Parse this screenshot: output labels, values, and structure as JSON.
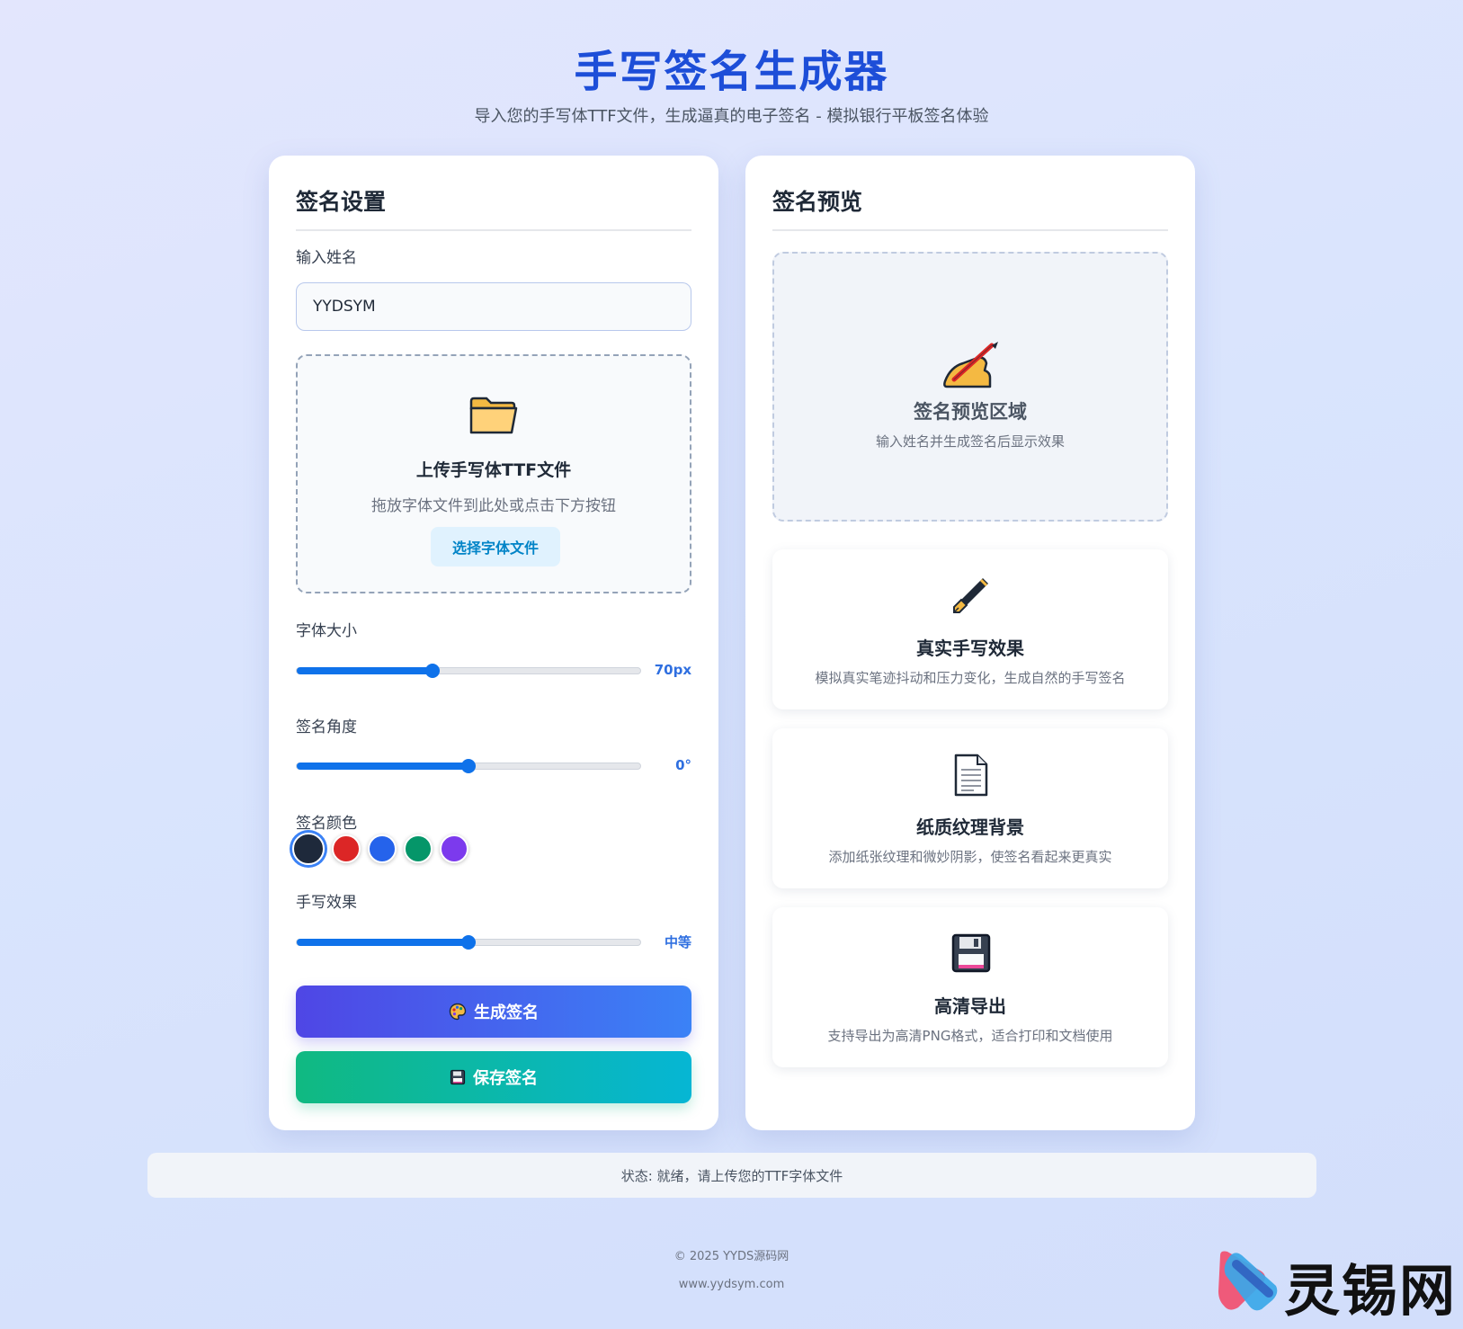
{
  "header": {
    "title": "手写签名生成器",
    "subtitle": "导入您的手写体TTF文件，生成逼真的电子签名 - 模拟银行平板签名体验"
  },
  "settings": {
    "title": "签名设置",
    "name_label": "输入姓名",
    "name_value": "YYDSYM",
    "upload": {
      "title": "上传手写体TTF文件",
      "hint": "拖放字体文件到此处或点击下方按钮",
      "button": "选择字体文件"
    },
    "font_size": {
      "label": "字体大小",
      "value_text": "70px",
      "fraction": 0.395
    },
    "angle": {
      "label": "签名角度",
      "value_text": "0°",
      "fraction": 0.5
    },
    "color": {
      "label": "签名颜色",
      "options": [
        "#1e293b",
        "#dc2626",
        "#2563eb",
        "#059669",
        "#7c3aed"
      ],
      "selected": 0
    },
    "effect": {
      "label": "手写效果",
      "value_text": "中等",
      "fraction": 0.5
    },
    "generate_button": "生成签名",
    "save_button": "保存签名"
  },
  "preview": {
    "title": "签名预览",
    "area_title": "签名预览区域",
    "area_hint": "输入姓名并生成签名后显示效果",
    "features": [
      {
        "icon": "fountain-pen-icon",
        "title": "真实手写效果",
        "desc": "模拟真实笔迹抖动和压力变化，生成自然的手写签名"
      },
      {
        "icon": "document-icon",
        "title": "纸质纹理背景",
        "desc": "添加纸张纹理和微妙阴影，使签名看起来更真实"
      },
      {
        "icon": "floppy-disk-icon",
        "title": "高清导出",
        "desc": "支持导出为高清PNG格式，适合打印和文档使用"
      }
    ]
  },
  "status": "状态: 就绪，请上传您的TTF字体文件",
  "footer": {
    "copyright": "© 2025 YYDS源码网",
    "site": "www.yydsym.com"
  },
  "watermark": {
    "text": "灵锡网"
  },
  "colors": {
    "accent": "#1d4ed8",
    "slider": "#0f72ea"
  }
}
